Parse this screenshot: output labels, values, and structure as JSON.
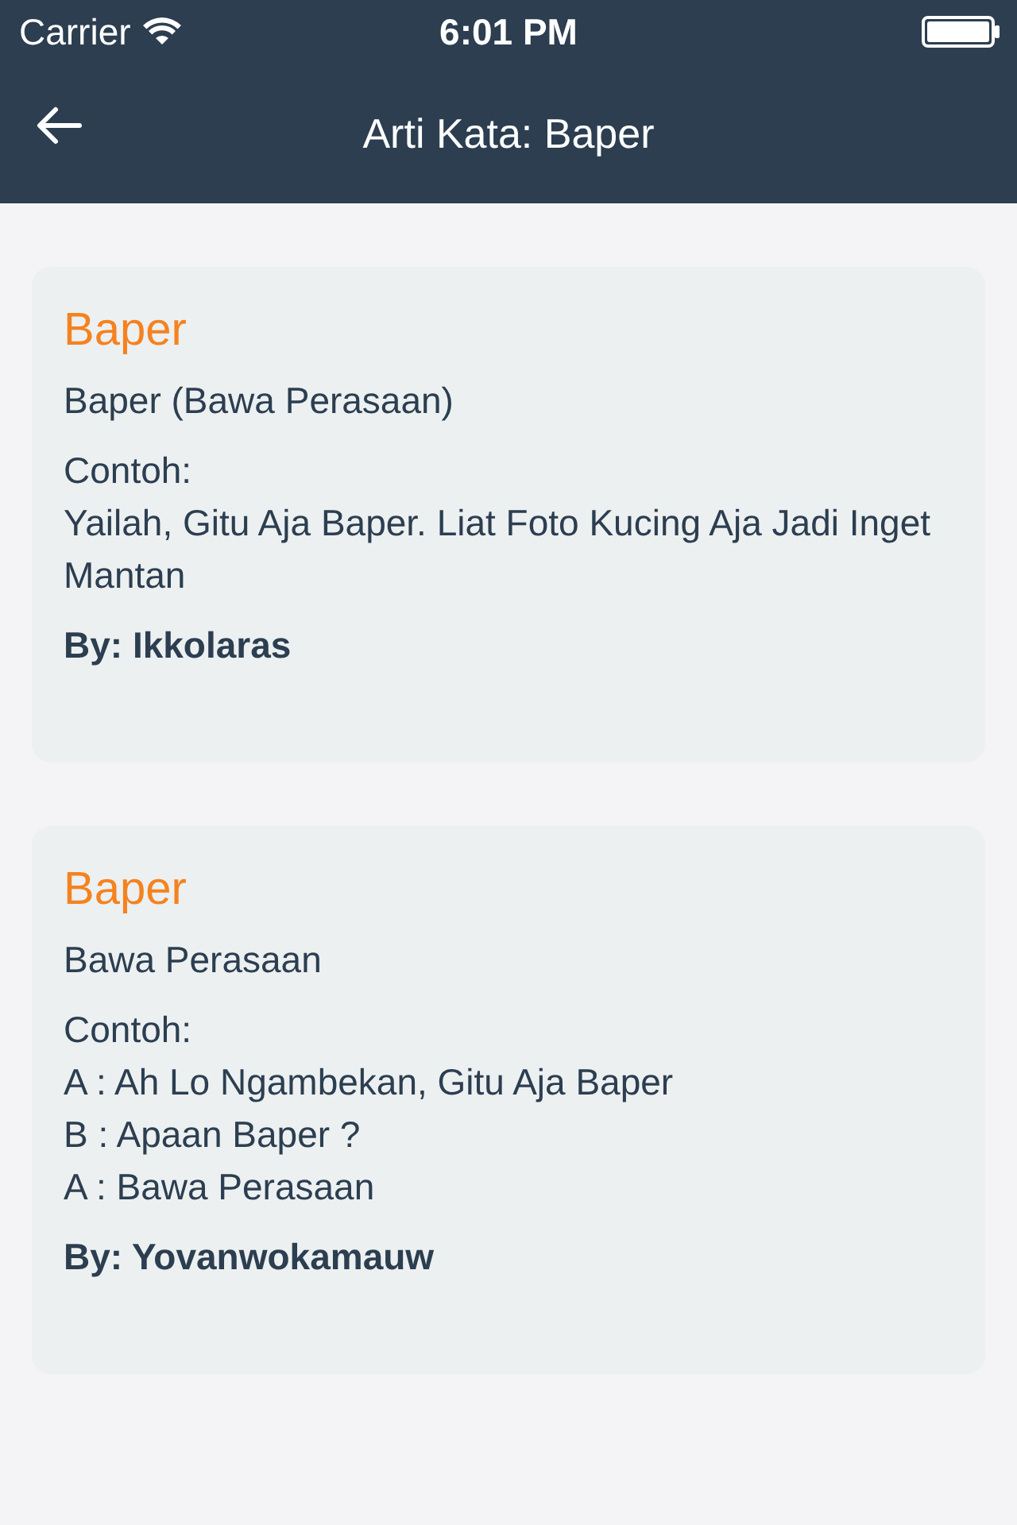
{
  "status_bar": {
    "carrier": "Carrier",
    "time": "6:01 PM"
  },
  "nav_bar": {
    "title": "Arti Kata: Baper"
  },
  "entries": [
    {
      "word": "Baper",
      "meaning": "Baper (Bawa Perasaan)",
      "example_label": "Contoh:",
      "example_lines": [
        "Yailah, Gitu Aja Baper. Liat Foto Kucing Aja Jadi Inget Mantan"
      ],
      "author": "By: Ikkolaras"
    },
    {
      "word": "Baper",
      "meaning": "Bawa Perasaan",
      "example_label": "Contoh:",
      "example_lines": [
        "A : Ah Lo Ngambekan, Gitu Aja Baper",
        "B : Apaan Baper ?",
        "A : Bawa Perasaan"
      ],
      "author": "By: Yovanwokamauw"
    }
  ]
}
